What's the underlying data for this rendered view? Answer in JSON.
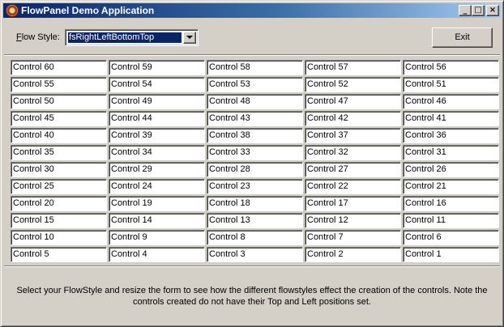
{
  "window": {
    "title": "FlowPanel Demo Application",
    "min_glyph": "_",
    "max_glyph": "□",
    "close_glyph": "×"
  },
  "toolbar": {
    "flow_label_accel": "F",
    "flow_label_rest": "low Style:",
    "flow_value": "fsRightLeftBottomTop",
    "exit_label": "Exit"
  },
  "panel": {
    "controls": [
      "Control 60",
      "Control 59",
      "Control 58",
      "Control 57",
      "Control 56",
      "Control 55",
      "Control 54",
      "Control 53",
      "Control 52",
      "Control 51",
      "Control 50",
      "Control 49",
      "Control 48",
      "Control 47",
      "Control 46",
      "Control 45",
      "Control 44",
      "Control 43",
      "Control 42",
      "Control 41",
      "Control 40",
      "Control 39",
      "Control 38",
      "Control 37",
      "Control 36",
      "Control 35",
      "Control 34",
      "Control 33",
      "Control 32",
      "Control 31",
      "Control 30",
      "Control 29",
      "Control 28",
      "Control 27",
      "Control 26",
      "Control 25",
      "Control 24",
      "Control 23",
      "Control 22",
      "Control 21",
      "Control 20",
      "Control 19",
      "Control 18",
      "Control 17",
      "Control 16",
      "Control 15",
      "Control 14",
      "Control 13",
      "Control 12",
      "Control 11",
      "Control 10",
      "Control 9",
      "Control 8",
      "Control 7",
      "Control 6",
      "Control 5",
      "Control 4",
      "Control 3",
      "Control 2",
      "Control 1"
    ]
  },
  "footer": {
    "info_text": "Select your FlowStyle and resize the form to see how the different flowstyles effect the creation of the controls. Note the controls created do not have their Top and Left positions set."
  }
}
